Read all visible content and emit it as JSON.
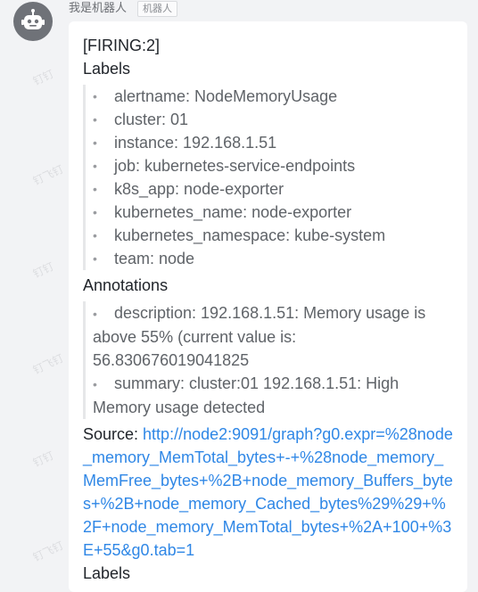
{
  "sender": {
    "name": "我是机器人",
    "tag": "机器人"
  },
  "watermark": {
    "text_short": "钉钉",
    "text_long": "钉飞钉"
  },
  "message": {
    "title": "[FIRING:2]",
    "labels_heading": "Labels",
    "labels": [
      "alertname: NodeMemoryUsage",
      "cluster: 01",
      "instance: 192.168.1.51",
      "job: kubernetes-service-endpoints",
      "k8s_app: node-exporter",
      "kubernetes_name: node-exporter",
      "kubernetes_namespace: kube-system",
      "team: node"
    ],
    "annotations_heading": "Annotations",
    "annotations": [
      "description: 192.168.1.51: Memory usage is above 55% (current value is: 56.830676019041825",
      "summary: cluster:01 192.168.1.51: High Memory usage detected"
    ],
    "source_label": "Source: ",
    "source_url": "http://node2:9091/graph?g0.expr=%28node_memory_MemTotal_bytes+-+%28node_memory_MemFree_bytes+%2B+node_memory_Buffers_bytes+%2B+node_memory_Cached_bytes%29%29+%2F+node_memory_MemTotal_bytes+%2A+100+%3E+55&g0.tab=1",
    "labels_heading_2": "Labels"
  },
  "colors": {
    "link": "#2f87e6",
    "avatar": "#6f7278",
    "background": "#f2f3f5"
  },
  "icons": {
    "avatar": "robot-icon",
    "bullet": "bullet-dot-icon"
  }
}
